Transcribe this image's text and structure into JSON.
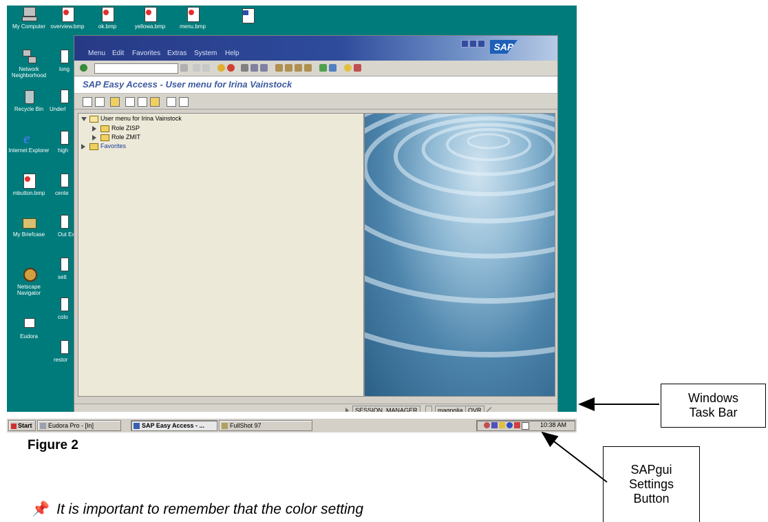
{
  "desktop": {
    "icons": [
      {
        "label": "My Computer"
      },
      {
        "label": "overview.bmp"
      },
      {
        "label": "ok.bmp"
      },
      {
        "label": "yellowa.bmp"
      },
      {
        "label": "menu.bmp"
      },
      {
        "label": "Network Neighborhood"
      },
      {
        "label": "long"
      },
      {
        "label": "Recycle Bin"
      },
      {
        "label": "Underl"
      },
      {
        "label": "Internet Explorer"
      },
      {
        "label": "high"
      },
      {
        "label": "mbutton.bmp"
      },
      {
        "label": "cente"
      },
      {
        "label": "My Briefcase"
      },
      {
        "label": "Out Exp"
      },
      {
        "label": "sett"
      },
      {
        "label": "Netscape Navigator"
      },
      {
        "label": "colo"
      },
      {
        "label": "Eudora"
      },
      {
        "label": "restor"
      }
    ],
    "background_color": "#007b7b"
  },
  "sap": {
    "menu": {
      "items": [
        "Menu",
        "Edit",
        "Favorites",
        "Extras",
        "System",
        "Help"
      ]
    },
    "logo_text": "SAP",
    "title": "SAP Easy Access  -  User menu for Irina Vainstock",
    "tree": {
      "root": "User menu for Irina Vainstock",
      "children": [
        "Role ZISP",
        "Role ZMIT"
      ],
      "favorites": "Favorites"
    },
    "status": {
      "system": "SESSION_MANAGER",
      "server": "magnolia",
      "mode": "OVR"
    },
    "colors": {
      "menu_bar": "#273a86",
      "title_text": "#3c5aa0",
      "background": "#d4d0c8"
    }
  },
  "taskbar": {
    "start": "Start",
    "tasks": [
      "Eudora Pro - [In]",
      "SAP Easy Access  - ...",
      "FullShot 97"
    ],
    "clock": "10:38 AM"
  },
  "annotations": {
    "figure_label": "Figure 2",
    "callout_taskbar": "Windows Task Bar",
    "callout_settings": "SAPgui Settings Button",
    "note": "It is important to remember that the color setting"
  }
}
